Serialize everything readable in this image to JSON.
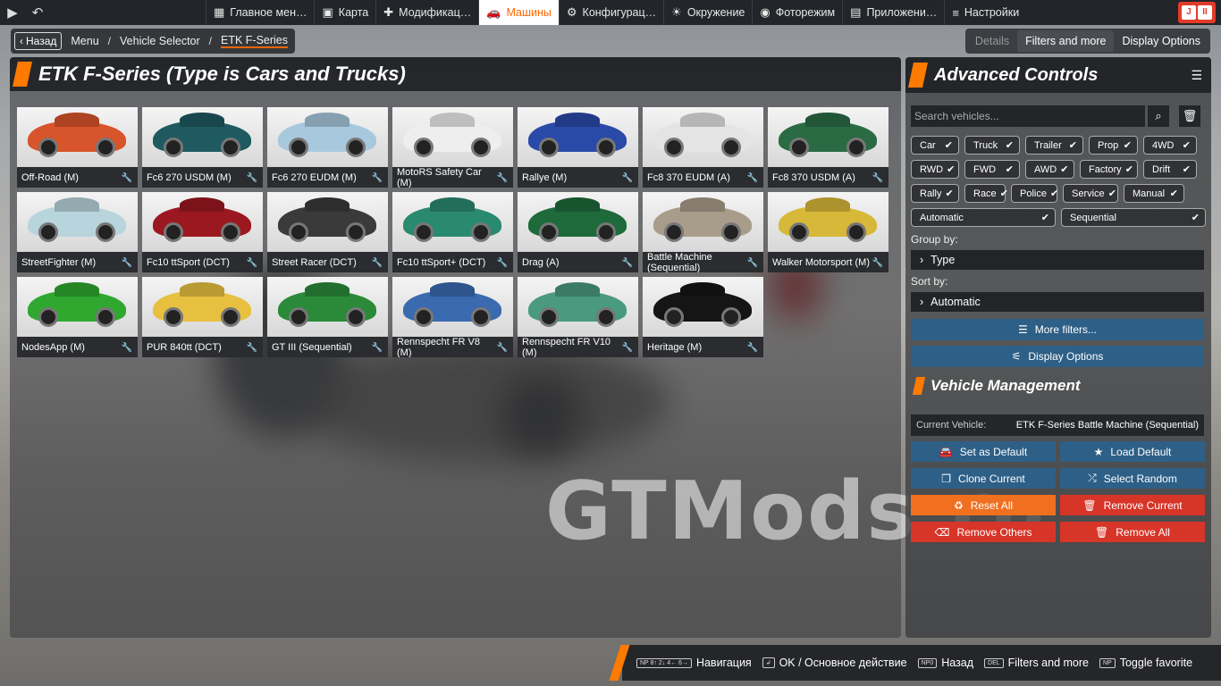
{
  "topbar": {
    "tabs": [
      {
        "icon": "grid-icon",
        "glyph": "▦",
        "label": "Главное мен…"
      },
      {
        "icon": "map-icon",
        "glyph": "▣",
        "label": "Карта"
      },
      {
        "icon": "puzzle-icon",
        "glyph": "✚",
        "label": "Модификац…"
      },
      {
        "icon": "car-icon",
        "glyph": "🚗",
        "label": "Машины"
      },
      {
        "icon": "config-car-icon",
        "glyph": "⚙",
        "label": "Конфигурац…"
      },
      {
        "icon": "environment-icon",
        "glyph": "☀",
        "label": "Окружение"
      },
      {
        "icon": "camera-icon",
        "glyph": "◉",
        "label": "Фоторежим"
      },
      {
        "icon": "apps-icon",
        "glyph": "▤",
        "label": "Приложени…"
      },
      {
        "icon": "settings-icon",
        "glyph": "≡",
        "label": "Настройки"
      }
    ],
    "active_tab": "Машины"
  },
  "breadcrumb": {
    "back_label": "Назад",
    "items": [
      "Menu",
      "Vehicle Selector",
      "ETK F-Series"
    ]
  },
  "viewtabs": {
    "details": "Details",
    "filters": "Filters and more",
    "display": "Display Options"
  },
  "main": {
    "title": "ETK F-Series (Type is Cars and Trucks)",
    "vehicles": [
      {
        "name": "Off-Road (M)",
        "color": "#d8542a"
      },
      {
        "name": "Fc6 270 USDM (M)",
        "color": "#1e5a60"
      },
      {
        "name": "Fc6 270 EUDM (M)",
        "color": "#a8c8de"
      },
      {
        "name": "MotoRS Safety Car (M)",
        "color": "#eeeeee"
      },
      {
        "name": "Rallye (M)",
        "color": "#2a4aa8"
      },
      {
        "name": "Fc8 370 EUDM (A)",
        "color": "#e4e4e4"
      },
      {
        "name": "Fc8 370 USDM (A)",
        "color": "#2a6b44"
      },
      {
        "name": "StreetFighter (M)",
        "color": "#b8d4dc"
      },
      {
        "name": "Fc10 ttSport (DCT)",
        "color": "#9c1820"
      },
      {
        "name": "Street Racer (DCT)",
        "color": "#3a3a3a"
      },
      {
        "name": "Fc10 ttSport+ (DCT)",
        "color": "#2a8a70"
      },
      {
        "name": "Drag (A)",
        "color": "#1e6a3a"
      },
      {
        "name": "Battle Machine (Sequential)",
        "color": "#a89c8a"
      },
      {
        "name": "Walker Motorsport (M)",
        "color": "#d8b838"
      },
      {
        "name": "NodesApp (M)",
        "color": "#30a830"
      },
      {
        "name": "PUR 840tt (DCT)",
        "color": "#e8c040"
      },
      {
        "name": "GT III (Sequential)",
        "color": "#2a8a3a"
      },
      {
        "name": "Rennspecht FR V8 (M)",
        "color": "#3a6ab0"
      },
      {
        "name": "Rennspecht FR V10 (M)",
        "color": "#4a9a80"
      },
      {
        "name": "Heritage (M)",
        "color": "#151515"
      }
    ]
  },
  "advanced": {
    "title": "Advanced Controls",
    "search_placeholder": "Search vehicles...",
    "chips": [
      {
        "label": "Car",
        "w": 54
      },
      {
        "label": "Truck",
        "w": 62
      },
      {
        "label": "Trailer",
        "w": 65
      },
      {
        "label": "Prop",
        "w": 55
      },
      {
        "label": "4WD",
        "w": 60
      },
      {
        "label": "RWD",
        "w": 54
      },
      {
        "label": "FWD",
        "w": 62
      },
      {
        "label": "AWD",
        "w": 55
      },
      {
        "label": "Factory",
        "w": 65
      },
      {
        "label": "Drift",
        "w": 60
      },
      {
        "label": "Rally",
        "w": 54
      },
      {
        "label": "Race",
        "w": 46
      },
      {
        "label": "Police",
        "w": 52
      },
      {
        "label": "Service",
        "w": 62
      },
      {
        "label": "Manual",
        "w": 68
      },
      {
        "label": "Automatic",
        "w": 162
      },
      {
        "label": "Sequential",
        "w": 162
      }
    ],
    "group_by_label": "Group by:",
    "group_by_value": "Type",
    "sort_by_label": "Sort by:",
    "sort_by_value": "Automatic",
    "more_filters": "More filters...",
    "display_options": "Display Options"
  },
  "vehicle_management": {
    "title": "Vehicle Management",
    "current_label": "Current Vehicle:",
    "current_value": "ETK F-Series Battle Machine (Sequential)",
    "set_default": "Set as Default",
    "load_default": "Load Default",
    "clone_current": "Clone Current",
    "select_random": "Select Random",
    "reset_all": "Reset All",
    "remove_current": "Remove Current",
    "remove_others": "Remove Others",
    "remove_all": "Remove All"
  },
  "watermark": "GTMods.ru",
  "bottom_hints": [
    {
      "key": "NP 8↑ 2↓ 4← 6→",
      "label": "Навигация"
    },
    {
      "key": "↲",
      "label": "OK / Основное действие"
    },
    {
      "key": "NP0",
      "label": "Назад"
    },
    {
      "key": "DEL",
      "label": "Filters and more"
    },
    {
      "key": "NP",
      "label": "Toggle favorite"
    }
  ]
}
